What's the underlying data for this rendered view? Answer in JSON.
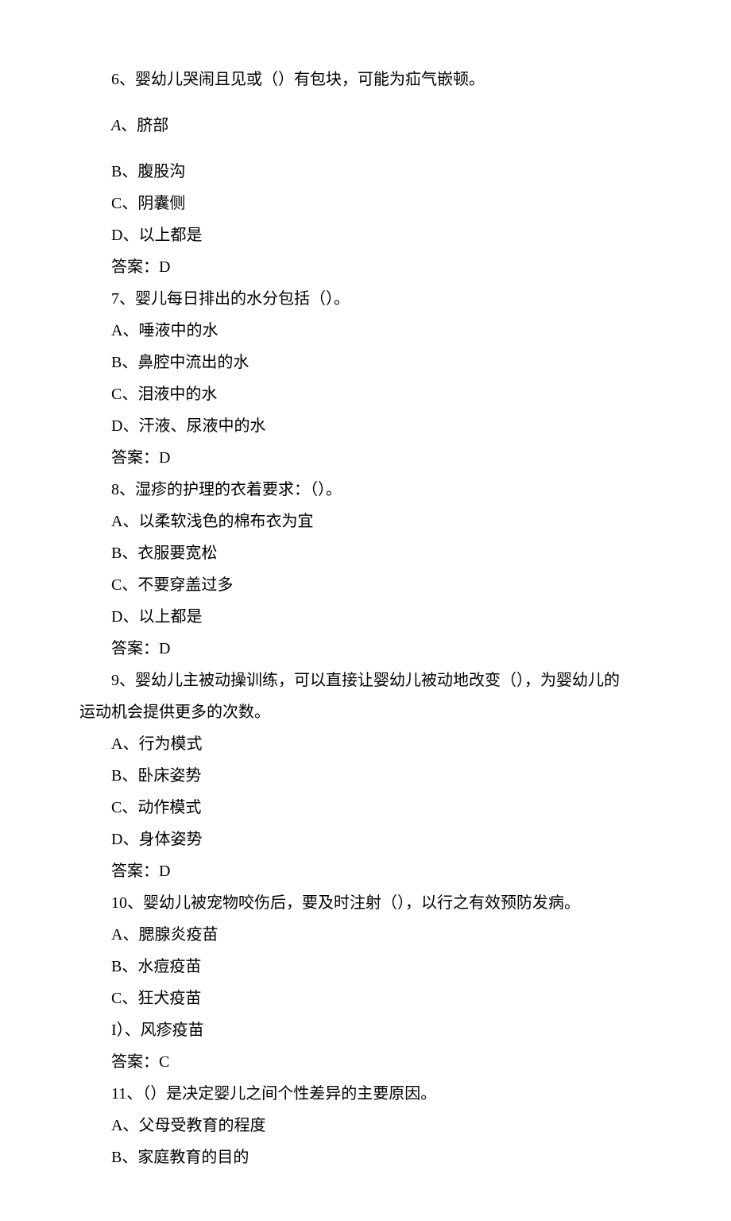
{
  "questions": [
    {
      "stem": "6、婴幼儿哭闹且见或（）有包块，可能为疝气嵌顿。",
      "options": [
        "A、脐部",
        "B、腹股沟",
        "C、阴囊侧",
        "D、以上都是"
      ],
      "answer": "答案：D",
      "firstOptionItalic": true,
      "firstSpaced": true
    },
    {
      "stem": "7、婴儿每日排出的水分包括（）。",
      "options": [
        "A、唾液中的水",
        "B、鼻腔中流出的水",
        "C、泪液中的水",
        "D、汗液、尿液中的水"
      ],
      "answer": "答案：D"
    },
    {
      "stem": "8、湿疹的护理的衣着要求：（）。",
      "options": [
        "A、以柔软浅色的棉布衣为宜",
        "B、衣服要宽松",
        "C、不要穿盖过多",
        "D、以上都是"
      ],
      "answer": "答案：D"
    },
    {
      "stem": "9、婴幼儿主被动操训练，可以直接让婴幼儿被动地改变（），为婴幼儿的运动机会提供更多的次数。",
      "options": [
        "A、行为模式",
        "B、卧床姿势",
        "C、动作模式",
        "D、身体姿势"
      ],
      "answer": "答案：D",
      "longStem": true
    },
    {
      "stem": "10、婴幼儿被宠物咬伤后，要及时注射（），以行之有效预防发病。",
      "options": [
        "A、腮腺炎疫苗",
        "B、水痘疫苗",
        "C、狂犬疫苗",
        "I）、风疹疫苗"
      ],
      "answer": "答案：C"
    },
    {
      "stem": "11、（）是决定婴儿之间个性差异的主要原因。",
      "options": [
        "A、父母受教育的程度",
        "B、家庭教育的目的"
      ],
      "answer": ""
    }
  ]
}
